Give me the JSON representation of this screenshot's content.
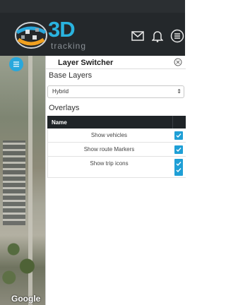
{
  "header": {
    "logo_text": "3D",
    "logo_subtext": "tracking",
    "icons": [
      "envelope-icon",
      "bell-icon",
      "menu-icon"
    ]
  },
  "map": {
    "attribution": "Google"
  },
  "layer_switcher": {
    "title": "Layer Switcher",
    "base_layers_label": "Base Layers",
    "base_layer_selected": "Hybrid",
    "overlays_label": "Overlays",
    "table_header": "Name",
    "overlays": [
      {
        "label": "Show vehicles",
        "checked": true
      },
      {
        "label": "Show route Markers",
        "checked": true
      },
      {
        "label": "Show trip icons",
        "checked": true
      }
    ]
  },
  "colors": {
    "header_bg": "#24282b",
    "accent": "#29a8dc",
    "checkbox": "#1e9fd6"
  }
}
